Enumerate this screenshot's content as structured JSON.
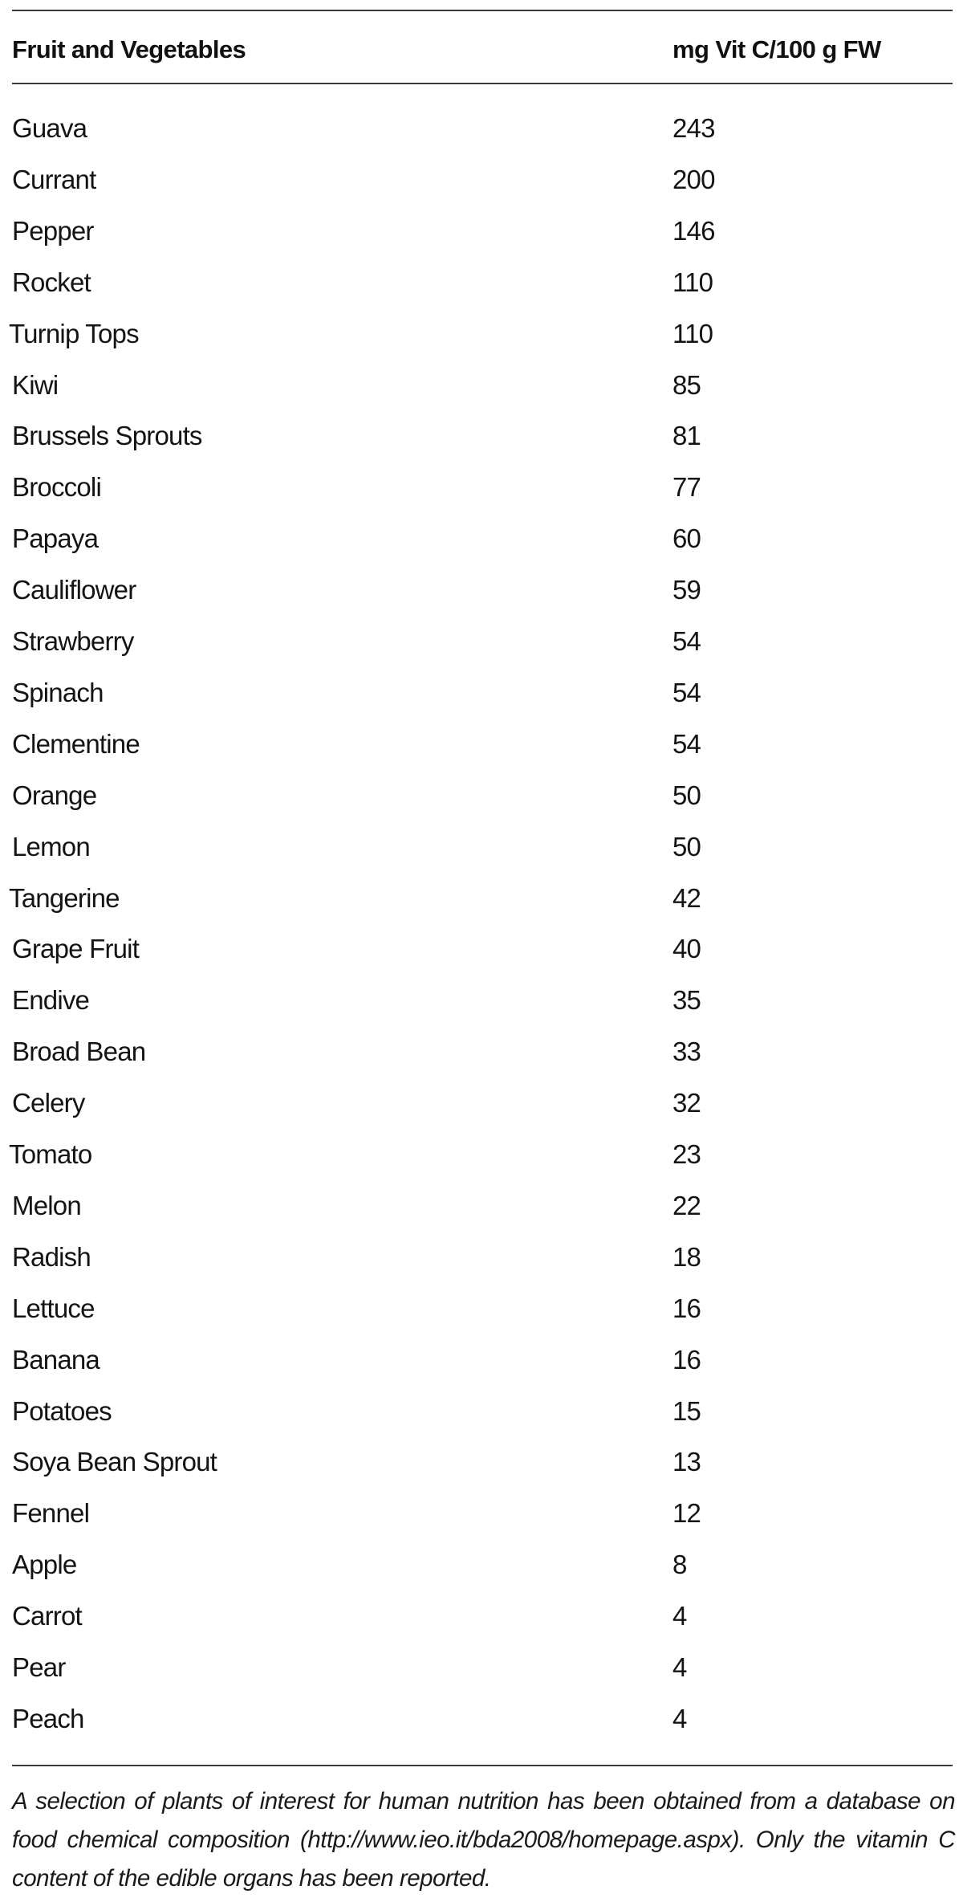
{
  "table": {
    "columns": [
      "Fruit and Vegetables",
      "mg Vit C/100 g FW"
    ],
    "rows": [
      {
        "name": "Guava",
        "value": "243"
      },
      {
        "name": "Currant",
        "value": "200"
      },
      {
        "name": "Pepper",
        "value": "146"
      },
      {
        "name": "Rocket",
        "value": "110"
      },
      {
        "name": "Turnip Tops",
        "value": "110"
      },
      {
        "name": "Kiwi",
        "value": "85"
      },
      {
        "name": "Brussels Sprouts",
        "value": "81"
      },
      {
        "name": "Broccoli",
        "value": "77"
      },
      {
        "name": "Papaya",
        "value": "60"
      },
      {
        "name": "Cauliflower",
        "value": "59"
      },
      {
        "name": "Strawberry",
        "value": "54"
      },
      {
        "name": "Spinach",
        "value": "54"
      },
      {
        "name": "Clementine",
        "value": "54"
      },
      {
        "name": "Orange",
        "value": "50"
      },
      {
        "name": "Lemon",
        "value": "50"
      },
      {
        "name": "Tangerine",
        "value": "42"
      },
      {
        "name": "Grape Fruit",
        "value": "40"
      },
      {
        "name": "Endive",
        "value": "35"
      },
      {
        "name": "Broad Bean",
        "value": "33"
      },
      {
        "name": "Celery",
        "value": "32"
      },
      {
        "name": "Tomato",
        "value": "23"
      },
      {
        "name": "Melon",
        "value": "22"
      },
      {
        "name": "Radish",
        "value": "18"
      },
      {
        "name": "Lettuce",
        "value": "16"
      },
      {
        "name": "Banana",
        "value": "16"
      },
      {
        "name": "Potatoes",
        "value": "15"
      },
      {
        "name": "Soya Bean Sprout",
        "value": "13"
      },
      {
        "name": "Fennel",
        "value": "12"
      },
      {
        "name": "Apple",
        "value": "8"
      },
      {
        "name": "Carrot",
        "value": "4"
      },
      {
        "name": "Pear",
        "value": "4"
      },
      {
        "name": "Peach",
        "value": "4"
      }
    ]
  },
  "caption": "A selection of plants of interest for human nutrition has been obtained from a database on food chemical composition (http://www.ieo.it/bda2008/homepage.aspx). Only the vitamin C content of the edible organs has been reported."
}
